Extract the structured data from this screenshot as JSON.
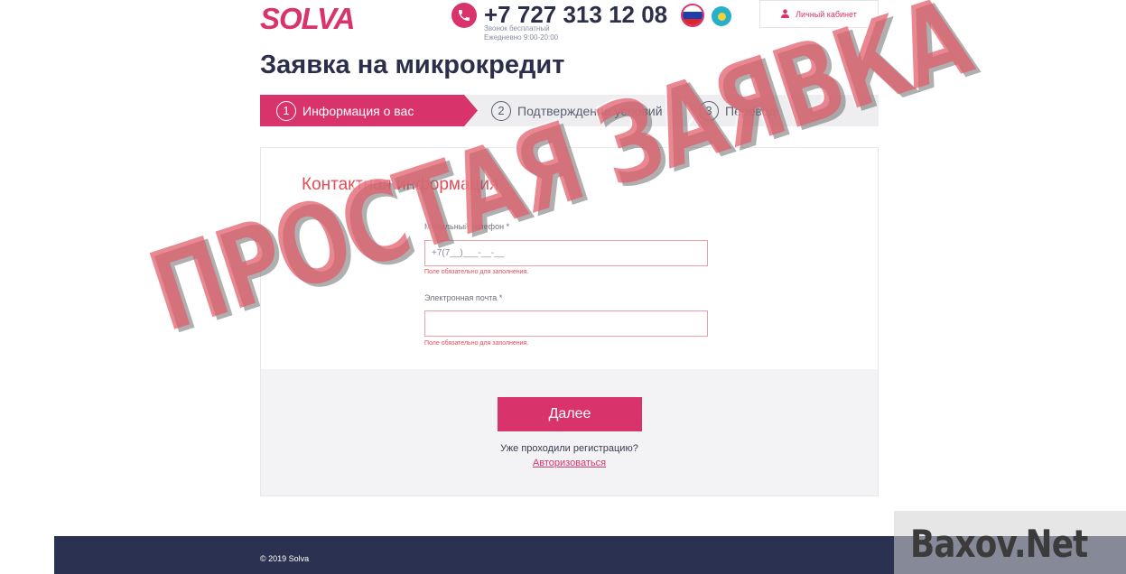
{
  "header": {
    "logo": "SOLVA",
    "phone": "+7 727 313 12 08",
    "phone_note_1": "Звонок бесплатный",
    "phone_note_2": "Ежедневно 9:00-20:00",
    "lang_flags": [
      "ru-flag-icon",
      "kz-flag-icon"
    ],
    "cabinet_label": "Личный кабинет"
  },
  "page_title": "Заявка на микрокредит",
  "steps": [
    {
      "num": "1",
      "label": "Информация о вас",
      "active": true
    },
    {
      "num": "2",
      "label": "Подтверждение условий",
      "active": false
    },
    {
      "num": "3",
      "label": "Перевод",
      "active": false
    }
  ],
  "form": {
    "section_title": "Контактная информация",
    "phone_label": "Мобильный телефон *",
    "phone_value": "+7(7__)___-__-__",
    "phone_error": "Поле обязательно для заполнения.",
    "email_label": "Электронная почта *",
    "email_value": "",
    "email_error": "Поле обязательно для заполнения.",
    "next_button": "Далее",
    "already_registered": "Уже проходили регистрацию?",
    "login_link": "Авторизоваться"
  },
  "footer": {
    "copyright": "© 2019 Solva"
  },
  "overlay": {
    "stamp_text": "ПРОСТАЯ ЗАЯВКА",
    "watermark": "Baxov.Net"
  },
  "colors": {
    "brand": "#d8336b",
    "error": "#e54b55",
    "dark": "#2b2f4a",
    "footer": "#2b3150"
  }
}
